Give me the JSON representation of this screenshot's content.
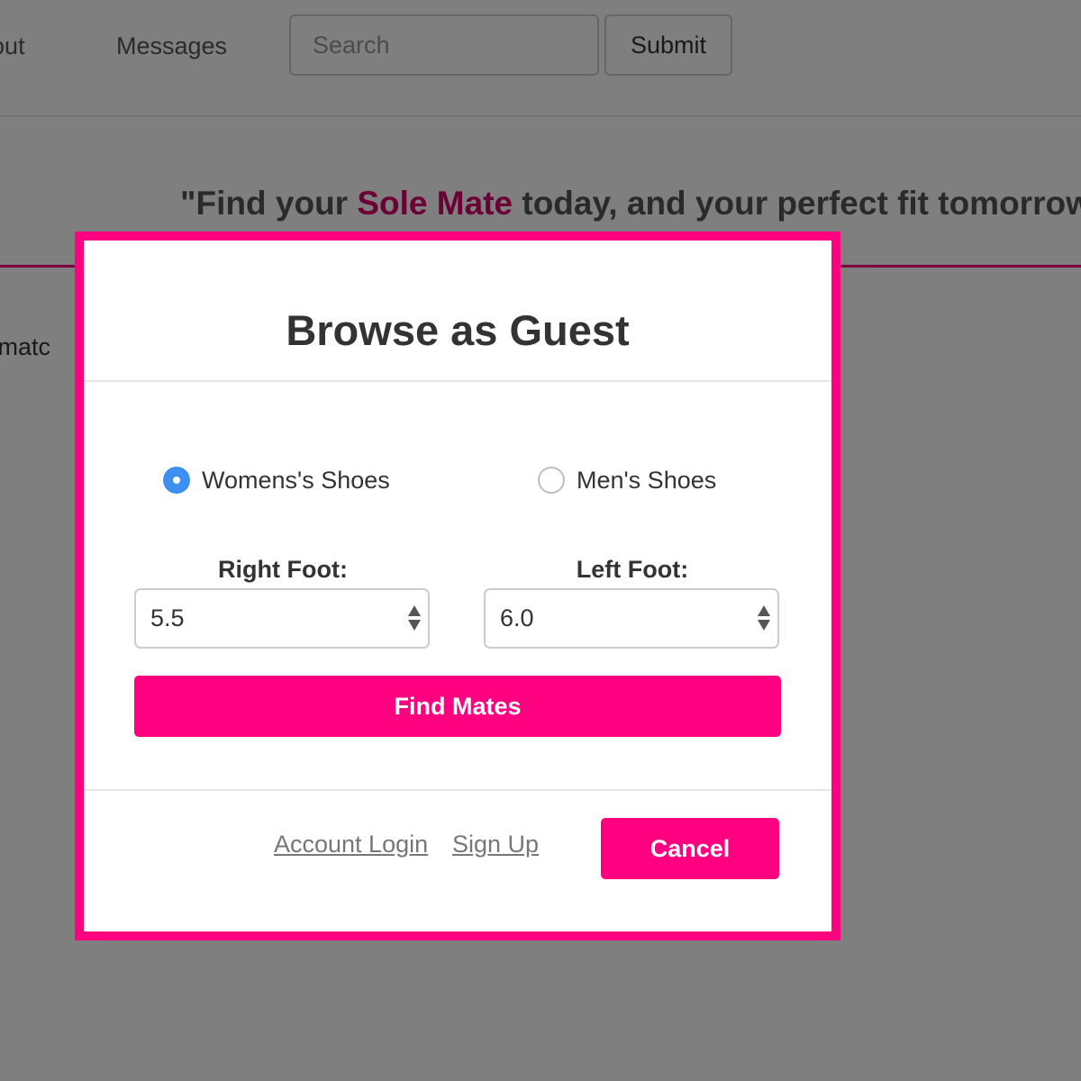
{
  "navbar": {
    "links": [
      "ogout",
      "Messages"
    ],
    "search_placeholder": "Search",
    "submit_label": "Submit"
  },
  "hero": {
    "quote_open": "\"Find your ",
    "brand": "Sole Mate",
    "quote_rest": " today, and your perfect fit tomorrow.\""
  },
  "background_text": "oe matc",
  "modal": {
    "title": "Browse as Guest",
    "gender_options": [
      {
        "label": "Womens's Shoes",
        "selected": true
      },
      {
        "label": "Men's Shoes",
        "selected": false
      }
    ],
    "right_foot": {
      "label": "Right Foot:",
      "value": "5.5"
    },
    "left_foot": {
      "label": "Left Foot:",
      "value": "6.0"
    },
    "find_label": "Find Mates",
    "footer": {
      "login_label": "Account Login",
      "signup_label": "Sign Up",
      "cancel_label": "Cancel"
    }
  },
  "colors": {
    "accent": "#ff0080",
    "brand_text": "#d6006f",
    "radio_selected": "#3d8ff2",
    "overlay": "rgba(0,0,0,0.5)"
  }
}
